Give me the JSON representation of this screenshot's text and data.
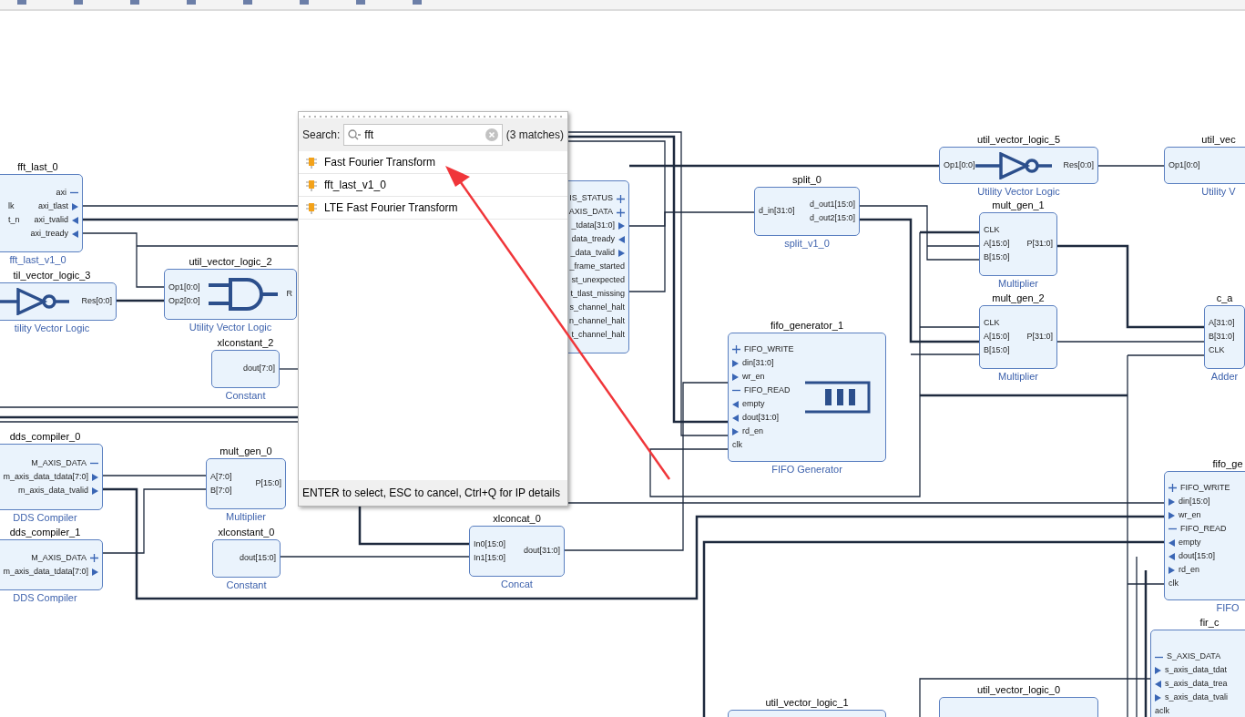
{
  "blocks": [
    {
      "kind": "plain",
      "title": "fft_last_0",
      "subtitle": "fft_last_v1_0",
      "left": [
        {
          "label": "lk",
          "kind": "plain"
        },
        {
          "label": "t_n",
          "kind": "plain"
        }
      ],
      "right": [
        {
          "label": "axi",
          "kind": "bus_minus"
        },
        {
          "label": "axi_tlast",
          "kind": "in_arrow"
        },
        {
          "label": "axi_tvalid",
          "kind": "out_arrow"
        },
        {
          "label": "axi_tready",
          "kind": "out_arrow"
        }
      ]
    },
    {
      "kind": "not",
      "title": "til_vector_logic_3",
      "subtitle": "tility Vector Logic",
      "right": [
        {
          "label": "Res[0:0]",
          "kind": "plain"
        }
      ]
    },
    {
      "kind": "and",
      "title": "util_vector_logic_2",
      "subtitle": "Utility Vector Logic",
      "left": [
        {
          "label": "Op1[0:0]",
          "kind": "plain"
        },
        {
          "label": "Op2[0:0]",
          "kind": "plain"
        }
      ],
      "right": [
        {
          "label": "R",
          "kind": "plain"
        }
      ]
    },
    {
      "kind": "plain",
      "title": "xlconstant_2",
      "subtitle": "Constant",
      "right": [
        {
          "label": "dout[7:0]",
          "kind": "plain"
        }
      ]
    },
    {
      "kind": "plain",
      "right": [
        {
          "label": "IS_STATUS",
          "kind": "bus_plus"
        },
        {
          "label": "AXIS_DATA",
          "kind": "bus_plus"
        },
        {
          "label": "_tdata[31:0]",
          "kind": "in_arrow"
        },
        {
          "label": "data_tready",
          "kind": "out_arrow"
        },
        {
          "label": "_data_tvalid",
          "kind": "in_arrow"
        },
        {
          "label": "_frame_started",
          "kind": "plain"
        },
        {
          "label": "st_unexpected",
          "kind": "plain"
        },
        {
          "label": "t_tlast_missing",
          "kind": "plain"
        },
        {
          "label": "s_channel_halt",
          "kind": "plain"
        },
        {
          "label": "n_channel_halt",
          "kind": "plain"
        },
        {
          "label": "t_channel_halt",
          "kind": "plain"
        }
      ]
    },
    {
      "kind": "plain",
      "title": "split_0",
      "subtitle": "split_v1_0",
      "left": [
        {
          "label": "d_in[31:0]",
          "kind": "plain"
        }
      ],
      "right": [
        {
          "label": "d_out1[15:0]",
          "kind": "plain"
        },
        {
          "label": "d_out2[15:0]",
          "kind": "plain"
        }
      ]
    },
    {
      "kind": "not",
      "title": "util_vector_logic_5",
      "subtitle": "Utility Vector Logic",
      "left": [
        {
          "label": "Op1[0:0]",
          "kind": "plain"
        }
      ],
      "right": [
        {
          "label": "Res[0:0]",
          "kind": "plain"
        }
      ]
    },
    {
      "kind": "plain",
      "title": "mult_gen_1",
      "subtitle": "Multiplier",
      "left": [
        {
          "label": "CLK",
          "kind": "plain"
        },
        {
          "label": "A[15:0]",
          "kind": "plain"
        },
        {
          "label": "B[15:0]",
          "kind": "plain"
        }
      ],
      "right": [
        {
          "label": "P[31:0]",
          "kind": "plain"
        }
      ]
    },
    {
      "kind": "plain",
      "title": "util_vec",
      "subtitle": "Utility V",
      "left": [
        {
          "label": "Op1[0:0]",
          "kind": "plain"
        }
      ]
    },
    {
      "kind": "plain",
      "title": "dds_compiler_0",
      "subtitle": "DDS Compiler",
      "right": [
        {
          "label": "M_AXIS_DATA",
          "kind": "bus_minus"
        },
        {
          "label": "m_axis_data_tdata[7:0]",
          "kind": "in_arrow"
        },
        {
          "label": "m_axis_data_tvalid",
          "kind": "in_arrow"
        }
      ]
    },
    {
      "kind": "plain",
      "title": "mult_gen_0",
      "subtitle": "Multiplier",
      "left": [
        {
          "label": "A[7:0]",
          "kind": "plain"
        },
        {
          "label": "B[7:0]",
          "kind": "plain"
        }
      ],
      "right": [
        {
          "label": "P[15:0]",
          "kind": "plain"
        }
      ]
    },
    {
      "kind": "fifo",
      "title": "fifo_generator_1",
      "subtitle": "FIFO Generator",
      "left": [
        {
          "label": "FIFO_WRITE",
          "kind": "bus_plus"
        },
        {
          "label": "din[31:0]",
          "kind": "in_arrow"
        },
        {
          "label": "wr_en",
          "kind": "in_arrow"
        },
        {
          "label": "FIFO_READ",
          "kind": "bus_minus"
        },
        {
          "label": "empty",
          "kind": "out_arrow"
        },
        {
          "label": "dout[31:0]",
          "kind": "out_arrow"
        },
        {
          "label": "rd_en",
          "kind": "in_arrow"
        },
        {
          "label": "clk",
          "kind": "plain"
        }
      ]
    },
    {
      "kind": "plain",
      "title": "mult_gen_2",
      "subtitle": "Multiplier",
      "left": [
        {
          "label": "CLK",
          "kind": "plain"
        },
        {
          "label": "A[15:0]",
          "kind": "plain"
        },
        {
          "label": "B[15:0]",
          "kind": "plain"
        }
      ],
      "right": [
        {
          "label": "P[31:0]",
          "kind": "plain"
        }
      ]
    },
    {
      "kind": "plain",
      "title": "c_a",
      "subtitle": "Adder",
      "left": [
        {
          "label": "A[31:0]",
          "kind": "plain"
        },
        {
          "label": "B[31:0]",
          "kind": "plain"
        },
        {
          "label": "CLK",
          "kind": "plain"
        }
      ]
    },
    {
      "kind": "plain",
      "title": "dds_compiler_1",
      "subtitle": "DDS Compiler",
      "right": [
        {
          "label": "M_AXIS_DATA",
          "kind": "bus_plus"
        },
        {
          "label": "m_axis_data_tdata[7:0]",
          "kind": "in_arrow"
        }
      ]
    },
    {
      "kind": "plain",
      "title": "xlconstant_0",
      "subtitle": "Constant",
      "right": [
        {
          "label": "dout[15:0]",
          "kind": "plain"
        }
      ]
    },
    {
      "kind": "plain",
      "title": "xlconcat_0",
      "subtitle": "Concat",
      "left": [
        {
          "label": "In0[15:0]",
          "kind": "plain"
        },
        {
          "label": "In1[15:0]",
          "kind": "plain"
        }
      ],
      "right": [
        {
          "label": "dout[31:0]",
          "kind": "plain"
        }
      ]
    },
    {
      "kind": "plain",
      "title": "fifo_ge",
      "subtitle": "FIFO",
      "left": [
        {
          "label": "FIFO_WRITE",
          "kind": "bus_plus"
        },
        {
          "label": "din[15:0]",
          "kind": "in_arrow"
        },
        {
          "label": "wr_en",
          "kind": "in_arrow"
        },
        {
          "label": "FIFO_READ",
          "kind": "bus_minus"
        },
        {
          "label": "empty",
          "kind": "out_arrow"
        },
        {
          "label": "dout[15:0]",
          "kind": "out_arrow"
        },
        {
          "label": "rd_en",
          "kind": "in_arrow"
        },
        {
          "label": "clk",
          "kind": "plain"
        }
      ]
    },
    {
      "kind": "plain",
      "title": "util_vector_logic_1"
    },
    {
      "kind": "plain",
      "title": "util_vector_logic_0"
    },
    {
      "kind": "plain",
      "title": "fir_c",
      "left": [
        {
          "label": "S_AXIS_DATA",
          "kind": "bus_minus"
        },
        {
          "label": "s_axis_data_tdat",
          "kind": "in_arrow"
        },
        {
          "label": "s_axis_data_trea",
          "kind": "out_arrow"
        },
        {
          "label": "s_axis_data_tvali",
          "kind": "in_arrow"
        },
        {
          "label": "aclk",
          "kind": "plain"
        }
      ]
    }
  ],
  "popup": {
    "search_label": "Search:",
    "query": "fft",
    "match_count": "(3 matches)",
    "results": [
      "Fast Fourier Transform",
      "fft_last_v1_0",
      "LTE Fast Fourier Transform"
    ],
    "footer": "ENTER to select, ESC to cancel, Ctrl+Q for IP details"
  }
}
